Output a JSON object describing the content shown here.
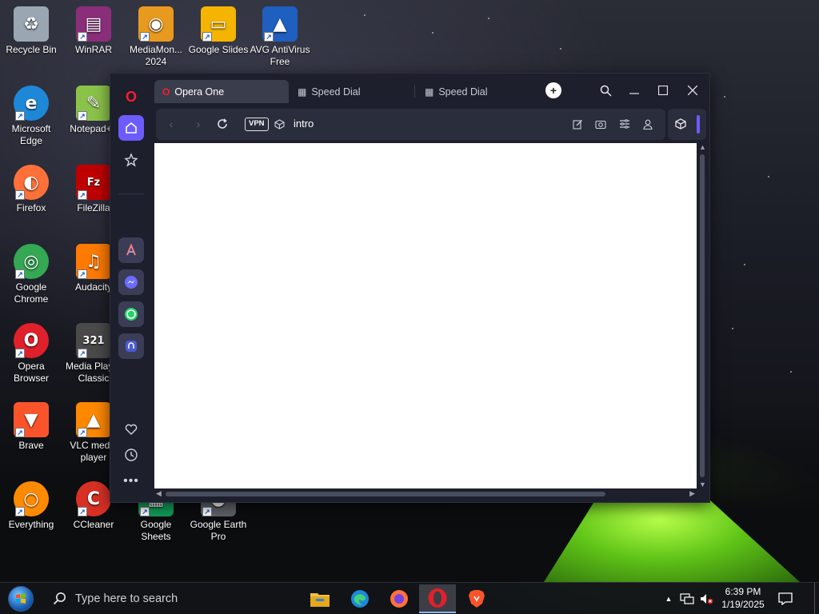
{
  "desktop": {
    "icons": [
      {
        "label": "Recycle Bin",
        "icon": "recycle-bin-icon",
        "color": "#9aa7b3"
      },
      {
        "label": "WinRAR",
        "icon": "winrar-icon",
        "color": "#8b2e7a"
      },
      {
        "label": "MediaMon... 2024",
        "icon": "mediamonkey-icon",
        "color": "#e89a1e"
      },
      {
        "label": "Google Slides",
        "icon": "google-slides-icon",
        "color": "#f4b400"
      },
      {
        "label": "AVG AntiVirus Free",
        "icon": "avg-icon",
        "color": "#1f5fbf"
      },
      {
        "label": "Microsoft Edge",
        "icon": "edge-icon",
        "color": "#1e88d8"
      },
      {
        "label": "Notepad++",
        "icon": "notepadpp-icon",
        "color": "#8bc34a"
      },
      {
        "label": "Firefox",
        "icon": "firefox-icon",
        "color": "#ff7139"
      },
      {
        "label": "FileZilla",
        "icon": "filezilla-icon",
        "color": "#bf0000"
      },
      {
        "label": "Google Chrome",
        "icon": "chrome-icon",
        "color": "#34a853"
      },
      {
        "label": "Audacity",
        "icon": "audacity-icon",
        "color": "#ff7a00"
      },
      {
        "label": "Opera Browser",
        "icon": "opera-icon",
        "color": "#e0202a"
      },
      {
        "label": "Media Player Classic",
        "icon": "mpc-icon",
        "color": "#4a4a4a"
      },
      {
        "label": "Brave",
        "icon": "brave-icon",
        "color": "#fb542b"
      },
      {
        "label": "VLC media player",
        "icon": "vlc-icon",
        "color": "#ff8800"
      },
      {
        "label": "Everything",
        "icon": "everything-icon",
        "color": "#ff8a00"
      },
      {
        "label": "CCleaner",
        "icon": "ccleaner-icon",
        "color": "#d93025"
      },
      {
        "label": "Google Sheets",
        "icon": "google-sheets-icon",
        "color": "#0f9d58"
      },
      {
        "label": "Google Earth Pro",
        "icon": "google-earth-icon",
        "color": "#5f6368"
      }
    ]
  },
  "opera": {
    "tabs": [
      {
        "label": "Opera One",
        "icon": "opera-tab-icon"
      },
      {
        "label": "Speed Dial",
        "icon": "speed-dial-icon"
      },
      {
        "label": "Speed Dial",
        "icon": "speed-dial-icon"
      }
    ],
    "address": {
      "vpn_label": "VPN",
      "url": "intro"
    },
    "accent": "#6c5cff",
    "sidebar": [
      "opera-logo-icon",
      "home-icon",
      "bookmarks-icon",
      "aria-icon",
      "messenger-icon",
      "whatsapp-icon",
      "music-player-icon",
      "heart-icon",
      "history-icon",
      "more-icon"
    ]
  },
  "taskbar": {
    "search_placeholder": "Type here to search",
    "apps": [
      "file-explorer-icon",
      "edge-icon",
      "firefox-icon",
      "opera-icon",
      "brave-icon"
    ],
    "clock_time": "6:39 PM",
    "clock_date": "1/19/2025"
  }
}
